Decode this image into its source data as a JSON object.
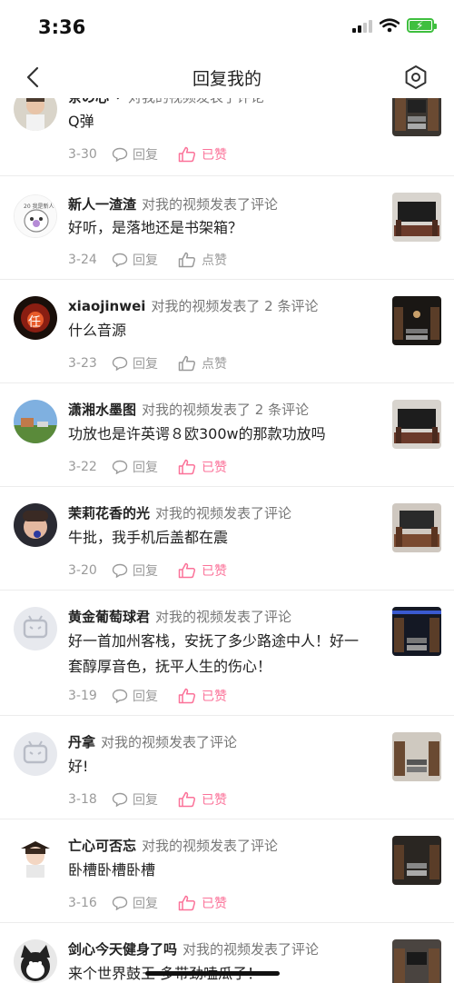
{
  "status": {
    "time": "3:36"
  },
  "header": {
    "title": "回复我的"
  },
  "comments": [
    {
      "user": "茶の心丶",
      "action": "对我的视频发表了评论",
      "text": "Q弹",
      "date": "3-30",
      "reply": "回复",
      "like": "已赞",
      "liked": true
    },
    {
      "user": "新人一渣渣",
      "action": "对我的视频发表了评论",
      "text": "好听，是落地还是书架箱？",
      "date": "3-24",
      "reply": "回复",
      "like": "点赞",
      "liked": false
    },
    {
      "user": "xiaojinwei",
      "action": "对我的视频发表了 2 条评论",
      "text": "什么音源",
      "date": "3-23",
      "reply": "回复",
      "like": "点赞",
      "liked": false
    },
    {
      "user": "潇湘水墨图",
      "action": "对我的视频发表了 2 条评论",
      "text": "功放也是许英谔８欧300w的那款功放吗",
      "date": "3-22",
      "reply": "回复",
      "like": "已赞",
      "liked": true
    },
    {
      "user": "茉莉花香的光",
      "action": "对我的视频发表了评论",
      "text": "牛批，我手机后盖都在震",
      "date": "3-20",
      "reply": "回复",
      "like": "已赞",
      "liked": true
    },
    {
      "user": "黄金葡萄球君",
      "action": "对我的视频发表了评论",
      "text": "好一首加州客栈，安抚了多少路途中人！好一套醇厚音色，抚平人生的伤心！",
      "date": "3-19",
      "reply": "回复",
      "like": "已赞",
      "liked": true
    },
    {
      "user": "丹拿",
      "action": "对我的视频发表了评论",
      "text": "好!",
      "date": "3-18",
      "reply": "回复",
      "like": "已赞",
      "liked": true
    },
    {
      "user": "亡心可否忘",
      "action": "对我的视频发表了评论",
      "text": "卧槽卧槽卧槽",
      "date": "3-16",
      "reply": "回复",
      "like": "已赞",
      "liked": true
    },
    {
      "user": "剑心今天健身了吗",
      "action": "对我的视频发表了评论",
      "text": "来个世界鼓王 多带劲嗑瓜子！",
      "date": "",
      "reply": "",
      "like": "",
      "liked": false
    }
  ],
  "colors": {
    "liked": "#fb7299",
    "muted": "#9a9a9a"
  }
}
